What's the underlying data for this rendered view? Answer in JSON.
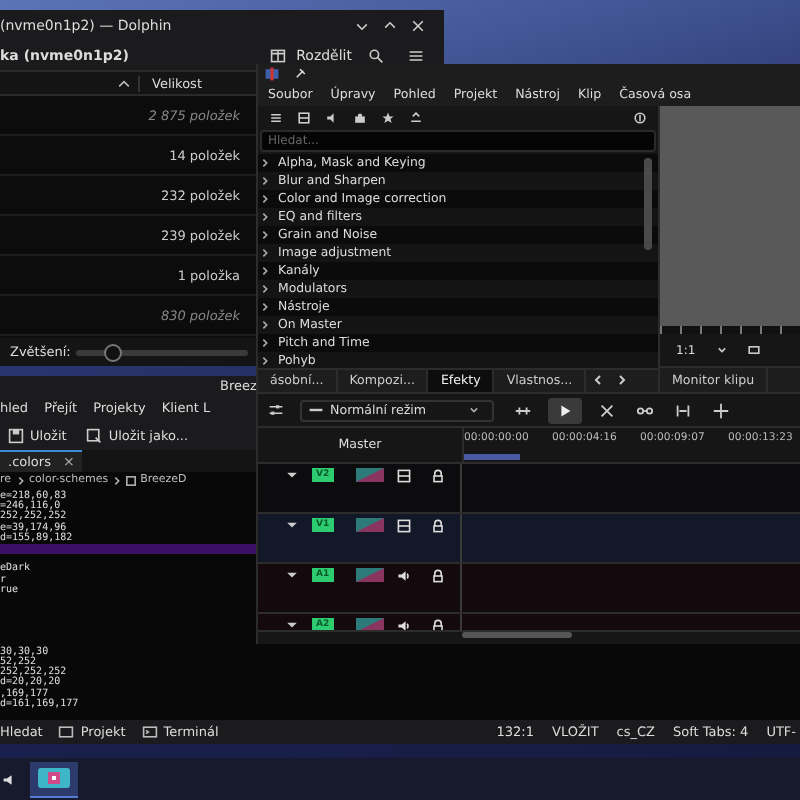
{
  "dolphin": {
    "title": "(nvme0n1p2) — Dolphin",
    "location": "ka (nvme0n1p2)",
    "split_button": "Rozdělit",
    "size_column": "Velikost",
    "rows": [
      {
        "size": "2 875 položek",
        "hidden": true
      },
      {
        "size": "14 položek",
        "hidden": false
      },
      {
        "size": "232 položek",
        "hidden": false
      },
      {
        "size": "239 položek",
        "hidden": false
      },
      {
        "size": "1 položka",
        "hidden": false
      },
      {
        "size": "830 položek",
        "hidden": true
      }
    ],
    "zoom": {
      "label": "Zvětšení:",
      "level": 0.2
    }
  },
  "kate": {
    "title": "Breez",
    "menu": [
      "hled",
      "Přejít",
      "Projekty",
      "Klient L"
    ],
    "toolbar": [
      "Uložit",
      "Uložit jako..."
    ],
    "tab": {
      "label": ".colors",
      "close": "×"
    },
    "breadcrumb": [
      "re",
      "color-schemes",
      "BreezeD"
    ],
    "code_blocks": [
      [
        "e=218,60,83",
        "=246,116,0",
        "252,252,252",
        "e=39,174,96",
        "d=155,89,182"
      ],
      [
        "eDark",
        "r",
        "rue"
      ],
      [
        "30,30,30",
        "52,252",
        "252,252,252",
        "d=20,20,20",
        ",169,177",
        "d=161,169,177"
      ]
    ],
    "status_left": [
      "Hledat",
      "Projekt",
      "Terminál"
    ],
    "status_right": [
      "132:1",
      "VLOŽIT",
      "cs_CZ",
      "Soft Tabs: 4",
      "UTF-"
    ]
  },
  "kdenlive": {
    "menu": [
      "Soubor",
      "Úpravy",
      "Pohled",
      "Projekt",
      "Nástroj",
      "Klip",
      "Časová osa"
    ],
    "search": {
      "placeholder": "Hledat..."
    },
    "effects": [
      "Alpha, Mask and Keying",
      "Blur and Sharpen",
      "Color and Image correction",
      "EQ and filters",
      "Grain and Noise",
      "Image adjustment",
      "Kanály",
      "Modulators",
      "Nástroje",
      "On Master",
      "Pitch and Time",
      "Pohyb"
    ],
    "tabs": [
      {
        "label": "ásobní...",
        "selected": false
      },
      {
        "label": "Kompozi...",
        "selected": false
      },
      {
        "label": "Efekty",
        "selected": true
      },
      {
        "label": "Vlastnos...",
        "selected": false
      }
    ],
    "monitor_tab": "Monitor klipu",
    "monitor_zoom": "1:1",
    "mode": "Normální režim",
    "master": "Master",
    "timecodes": [
      "00:00:00:00",
      "00:00:04:16",
      "00:00:09:07",
      "00:00:13:23"
    ],
    "tracks": [
      {
        "name": "V2",
        "kind": "video",
        "selected": false
      },
      {
        "name": "V1",
        "kind": "video",
        "selected": true
      },
      {
        "name": "A1",
        "kind": "audio",
        "selected": false
      },
      {
        "name": "A2",
        "kind": "audio",
        "selected": false
      }
    ]
  }
}
